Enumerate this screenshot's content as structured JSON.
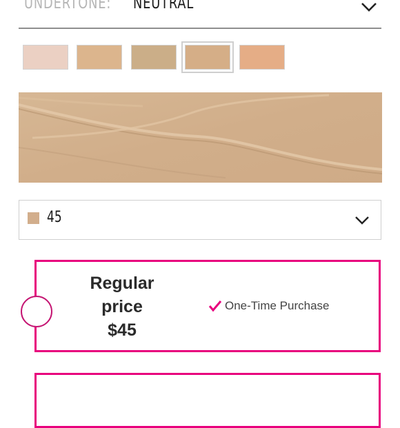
{
  "undertone": {
    "label": "UNDERTONE:",
    "value": "NEUTRAL",
    "icon": "chevron-down-icon"
  },
  "swatches": [
    {
      "color": "#ebd0c3",
      "selected": false
    },
    {
      "color": "#dcb58d",
      "selected": false
    },
    {
      "color": "#cbae88",
      "selected": false
    },
    {
      "color": "#d5ae87",
      "selected": true
    },
    {
      "color": "#e5ad86",
      "selected": false
    }
  ],
  "texture": {
    "base_color": "#d2b08d"
  },
  "shade_select": {
    "selected": "45",
    "chip_color": "#d2ae8c",
    "icon": "chevron-down-icon"
  },
  "purchase_options": [
    {
      "price_line1": "Regular",
      "price_line2": "price",
      "price_line3": "$45",
      "option_label": "One-Time Purchase",
      "icon": "checkmark-icon"
    }
  ],
  "colors": {
    "accent": "#e8007d",
    "radio_border": "#c51673",
    "divider": "#8e8e8e"
  }
}
